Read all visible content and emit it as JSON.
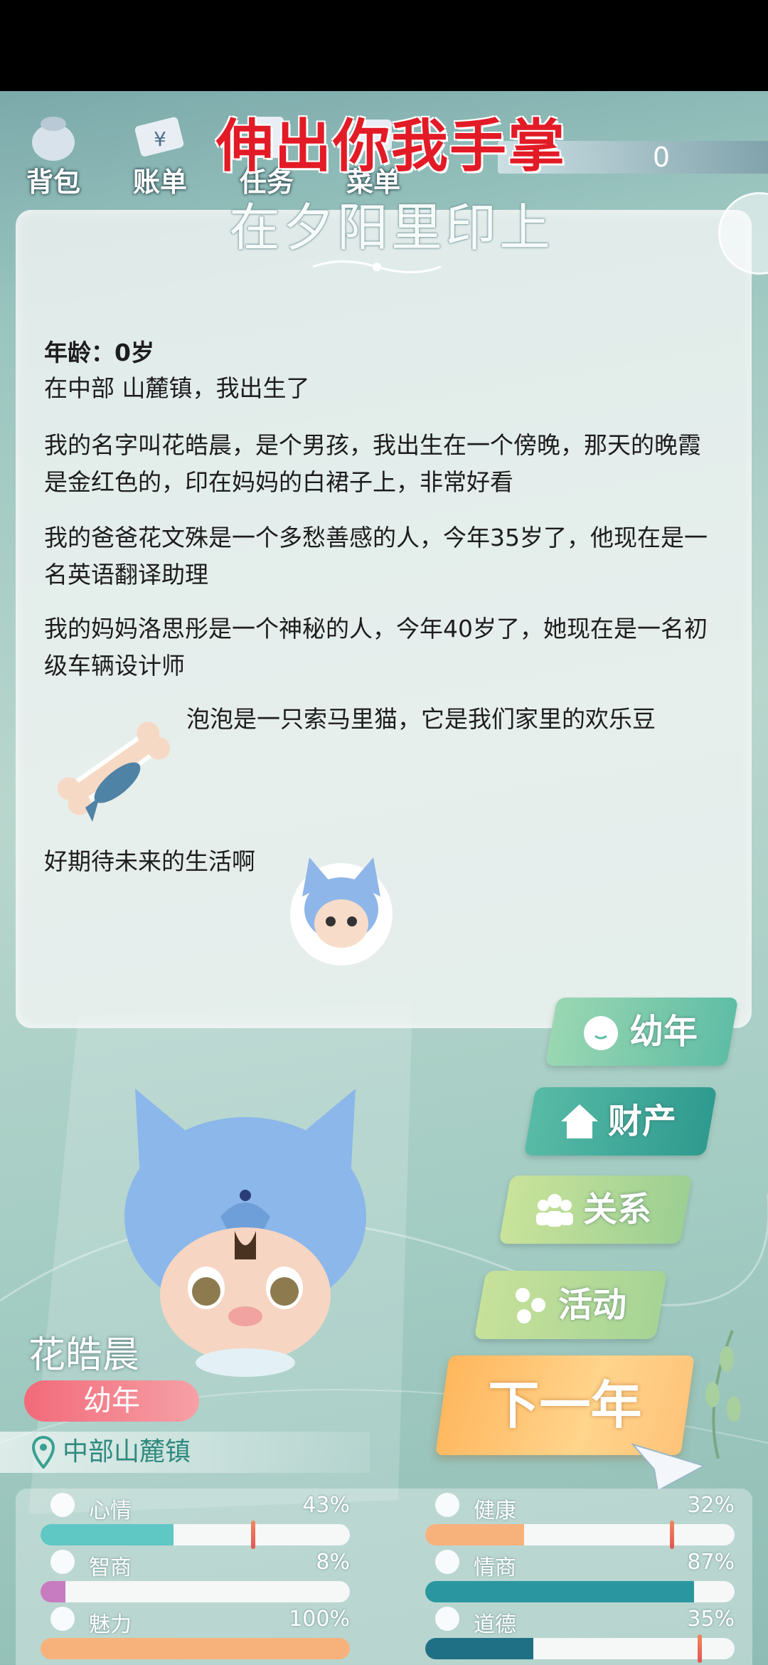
{
  "header": {
    "nav": [
      {
        "label": "背包",
        "icon": "backpack-icon"
      },
      {
        "label": "账单",
        "icon": "bill-icon"
      },
      {
        "label": "任务",
        "icon": "task-icon"
      },
      {
        "label": "菜单",
        "icon": "menu-icon"
      }
    ],
    "banner_line1": "伸出你我手掌",
    "banner_line2": "在夕阳里印上",
    "counter": "0"
  },
  "story": {
    "age_line": "年龄：0岁",
    "born_line": "在中部 山麓镇，我出生了",
    "paragraph1": "我的名字叫花皓晨，是个男孩，我出生在一个傍晚，那天的晚霞是金红色的，印在妈妈的白裙子上，非常好看",
    "paragraph2": "我的爸爸花文殊是一个多愁善感的人，今年35岁了，他现在是一名英语翻译助理",
    "paragraph3": "我的妈妈洛思彤是一个神秘的人，今年40岁了，她现在是一名初级车辆设计师",
    "pet_line": "泡泡是一只索马里猫，它是我们家里的欢乐豆",
    "closing_line": "好期待未来的生活啊"
  },
  "side_buttons": {
    "stage": "幼年",
    "assets": "财产",
    "relations": "关系",
    "activities": "活动"
  },
  "next_year": "下一年",
  "character": {
    "name": "花皓晨",
    "stage": "幼年",
    "location": "中部山麓镇"
  },
  "stats": [
    {
      "label": "心情",
      "value": "43%",
      "fill": 0.43,
      "color": "#5fc7c4",
      "marker": 0.68
    },
    {
      "label": "健康",
      "value": "32%",
      "fill": 0.32,
      "color": "#f7b27c",
      "marker": 0.79
    },
    {
      "label": "智商",
      "value": "8%",
      "fill": 0.08,
      "color": "#c77bc0",
      "marker": null
    },
    {
      "label": "情商",
      "value": "87%",
      "fill": 0.87,
      "color": "#2a97a0",
      "marker": null
    },
    {
      "label": "魅力",
      "value": "100%",
      "fill": 1.0,
      "color": "#f7b27c",
      "marker": null
    },
    {
      "label": "道德",
      "value": "35%",
      "fill": 0.35,
      "color": "#1f6f85",
      "marker": 0.88
    }
  ],
  "colors": {
    "banner_red": "#e21b26",
    "stage_pill": "#f26a7a",
    "next_year": "#ffb65c"
  }
}
